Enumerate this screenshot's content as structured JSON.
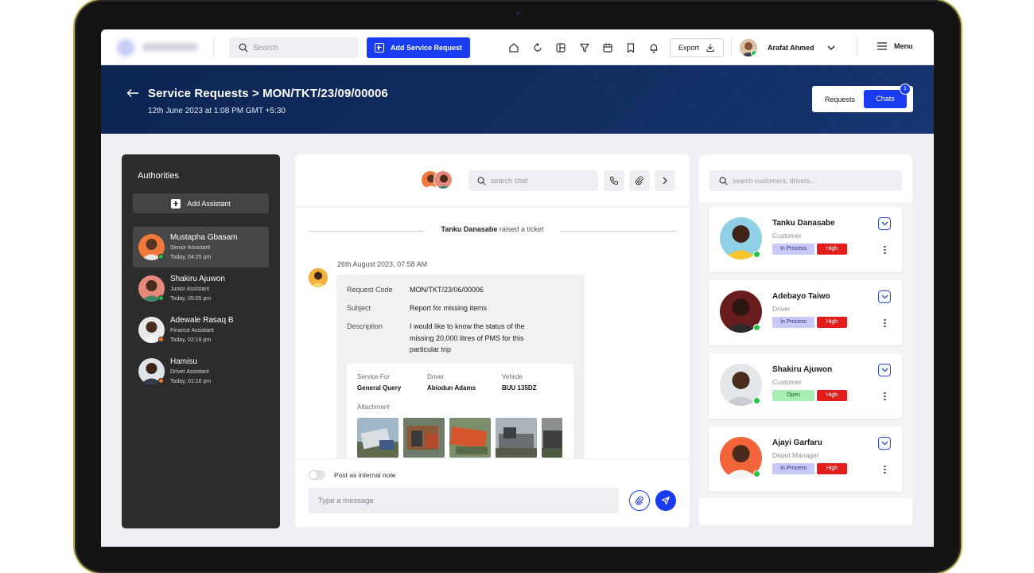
{
  "topbar": {
    "search_placeholder": "Search",
    "add_button": "Add Service Request",
    "export_label": "Export",
    "user_name": "Arafat Ahmed",
    "menu_label": "Menu",
    "nav_icons": [
      "home-icon",
      "refresh-icon",
      "grid-icon",
      "filter-icon",
      "calendar-icon",
      "bookmark-icon",
      "bell-icon"
    ]
  },
  "header": {
    "title": "Service Requests > MON/TKT/23/09/00006",
    "subtitle": "12th June 2023 at 1:08 PM GMT +5:30",
    "tabs": [
      {
        "label": "Requests"
      },
      {
        "label": "Chats",
        "badge": "1"
      }
    ]
  },
  "authorities": {
    "title": "Authorities",
    "add_label": "Add Assistant",
    "items": [
      {
        "name": "Mustapha Gbasam",
        "role": "Senior Assistant",
        "time": "Today, 04:25 pm",
        "status_color": "#28c24b"
      },
      {
        "name": "Shakiru Ajuwon",
        "role": "Junior Assistant",
        "time": "Today, 05:05 pm",
        "status_color": "#28c24b"
      },
      {
        "name": "Adewale Rasaq B",
        "role": "Finance Assistant",
        "time": "Today, 02:16 pm",
        "status_color": "#f0762a"
      },
      {
        "name": "Hamisu",
        "role": "Driver Assistant",
        "time": "Today, 01:16 pm",
        "status_color": "#f0762a"
      }
    ]
  },
  "chat": {
    "search_placeholder": "search chat",
    "raised_name": "Tanku Danasabe",
    "raised_text": "raised a ticket",
    "message": {
      "time": "26th August 2023, 07:58 AM",
      "request_code_label": "Request Code",
      "request_code": "MON/TKT/23/06/00006",
      "subject_label": "Subject",
      "subject": "Report for missing items",
      "description_label": "Description",
      "description_lines": [
        "I would like to know the status of the",
        "missing 20,000 litres of PMS for this",
        "particular trip"
      ],
      "service_for_label": "Service For",
      "service_for": "General Query",
      "driver_label": "Driver",
      "driver": "Abiodun Adams",
      "vehicle_label": "Vehicle",
      "vehicle": "BUU 135DZ",
      "attachment_label": "Attachment"
    },
    "internal_note_label": "Post as internal note",
    "input_placeholder": "Type a message"
  },
  "customers": {
    "search_placeholder": "search customers, drivers...",
    "items": [
      {
        "name": "Tanku Danasabe",
        "role": "Customer",
        "status": "In Process",
        "priority": "High"
      },
      {
        "name": "Adebayo Taiwo",
        "role": "Driver",
        "status": "In Process",
        "priority": "High"
      },
      {
        "name": "Shakiru Ajuwon",
        "role": "Customer",
        "status": "Open",
        "priority": "High"
      },
      {
        "name": "Ajayi Garfaru",
        "role": "Depot Manager",
        "status": "In Process",
        "priority": "High"
      }
    ]
  },
  "colors": {
    "accent": "#1a3cf0",
    "header_bg": "#0c2553",
    "status_in_process": "#c8c9f8",
    "status_open": "#a9efb4",
    "priority_high": "#e31c1c"
  }
}
